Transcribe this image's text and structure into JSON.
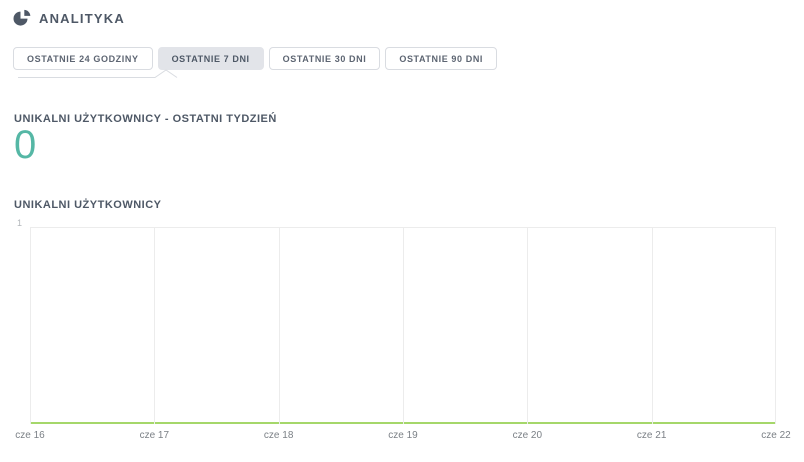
{
  "header": {
    "title": "ANALITYKA",
    "icon": "pie-chart-icon"
  },
  "filters": {
    "buttons": [
      {
        "label": "OSTATNIE 24 GODZINY",
        "active": false
      },
      {
        "label": "OSTATNIE 7 DNI",
        "active": true
      },
      {
        "label": "OSTATNIE 30 DNI",
        "active": false
      },
      {
        "label": "OSTATNIE 90 DNI",
        "active": false
      }
    ]
  },
  "stat": {
    "label": "UNIKALNI UŻYTKOWNICY - OSTATNI TYDZIEŃ",
    "value": "0"
  },
  "colors": {
    "accent_teal": "#55b7a5",
    "series_green": "#a5d76a",
    "text_slate": "#4e5866",
    "gridline": "#ececec",
    "button_border": "#d9dce1",
    "active_button_bg": "#e2e4e9"
  },
  "chart_data": {
    "type": "line",
    "title": "UNIKALNI UŻYTKOWNICY",
    "x": [
      "cze 16",
      "cze 17",
      "cze 18",
      "cze 19",
      "cze 20",
      "cze 21",
      "cze 22"
    ],
    "series": [
      {
        "name": "Unikalni użytkownicy",
        "values": [
          0,
          0,
          0,
          0,
          0,
          0,
          0
        ]
      }
    ],
    "xlabel": "",
    "ylabel": "",
    "ylim": [
      0,
      1
    ],
    "yticks": [
      "1"
    ],
    "grid": "vertical-only",
    "legend": "none",
    "line_color": "#a5d76a"
  }
}
